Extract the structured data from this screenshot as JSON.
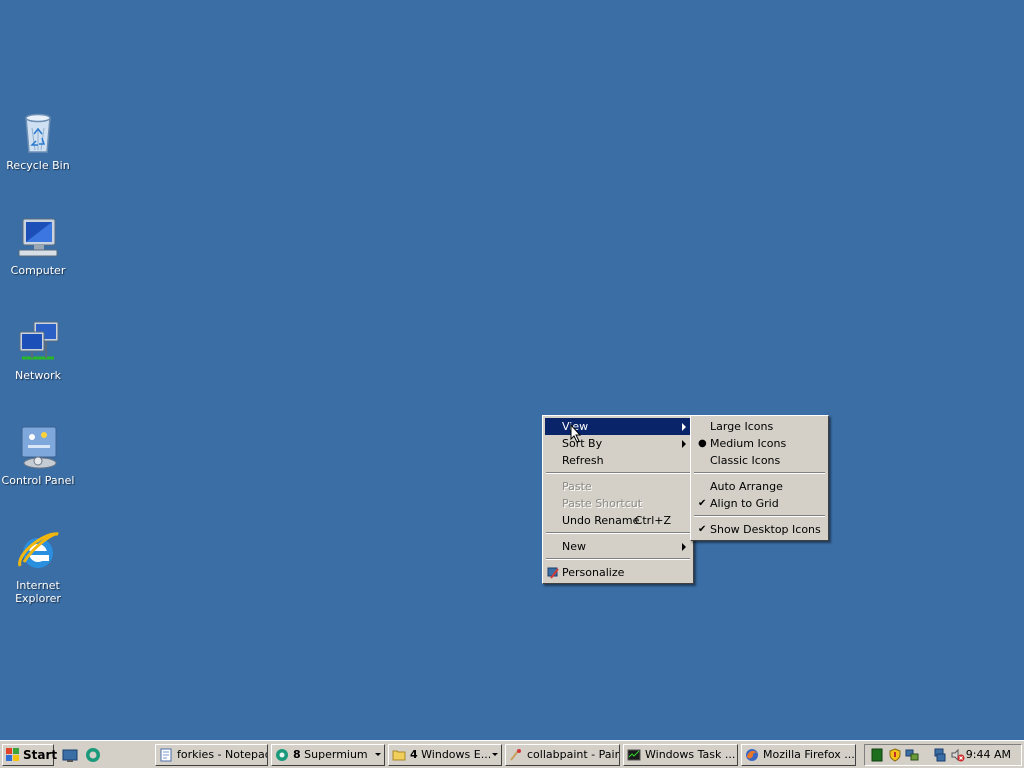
{
  "desktop": {
    "icons": [
      {
        "label": "Recycle Bin",
        "icon": "recycle-bin-icon"
      },
      {
        "label": "Computer",
        "icon": "computer-icon"
      },
      {
        "label": "Network",
        "icon": "network-icon"
      },
      {
        "label": "Control Panel",
        "icon": "control-panel-icon"
      },
      {
        "label": "Internet Explorer",
        "icon": "internet-explorer-icon"
      }
    ]
  },
  "context_menu": {
    "items": {
      "view": "View",
      "sort_by": "Sort By",
      "refresh": "Refresh",
      "paste": "Paste",
      "paste_shortcut": "Paste Shortcut",
      "undo_rename": "Undo Rename",
      "undo_shortcut": "Ctrl+Z",
      "new": "New",
      "personalize": "Personalize"
    }
  },
  "view_submenu": {
    "large_icons": "Large Icons",
    "medium_icons": "Medium Icons",
    "classic_icons": "Classic Icons",
    "auto_arrange": "Auto Arrange",
    "align_to_grid": "Align to Grid",
    "show_desktop_icons": "Show Desktop Icons",
    "selected_size": "Medium Icons"
  },
  "taskbar": {
    "start_label": "Start",
    "tasks": [
      {
        "label": "forkies - Notepad",
        "icon": "notepad-icon"
      },
      {
        "count": "8",
        "label": "Supermium",
        "icon": "supermium-icon"
      },
      {
        "count": "4",
        "label": "Windows E...",
        "icon": "folder-icon"
      },
      {
        "label": "collabpaint - Paint",
        "icon": "paint-icon"
      },
      {
        "label": "Windows Task ...",
        "icon": "task-manager-icon"
      },
      {
        "label": "Mozilla Firefox ...",
        "icon": "firefox-icon"
      }
    ],
    "clock": "9:44 AM"
  },
  "colors": {
    "desktop_background": "#3a6ea5",
    "menu_highlight": "#0a246a",
    "face": "#d4d0c8"
  }
}
